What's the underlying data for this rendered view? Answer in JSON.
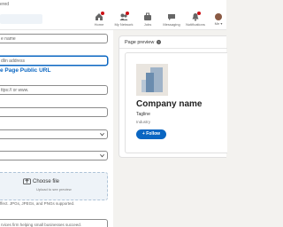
{
  "breadcrumb": "ered",
  "nav": {
    "items": [
      {
        "label": "Home",
        "icon": "home-icon",
        "badge": true
      },
      {
        "label": "My Network",
        "icon": "network-icon",
        "badge": true
      },
      {
        "label": "Jobs",
        "icon": "jobs-icon",
        "badge": false
      },
      {
        "label": "Messaging",
        "icon": "messaging-icon",
        "badge": false
      },
      {
        "label": "Notifications",
        "icon": "bell-icon",
        "badge": true
      },
      {
        "label": "Me ▾",
        "icon": "avatar",
        "badge": false
      }
    ]
  },
  "form": {
    "name_placeholder": "e name",
    "url_placeholder": "dlin address",
    "public_url_label": "e Page Public URL",
    "website_placeholder": "ttps:// or www.",
    "upload": {
      "title": "Choose file",
      "subtitle": "Upload to see preview",
      "note": "ffect. JPGs, JPEGs, and PNGs supported."
    },
    "tagline_placeholder": "rvices firm helping small businesses succeed."
  },
  "preview": {
    "heading": "Page preview",
    "company_name": "Company name",
    "tagline": "Tagline",
    "industry": "Industry",
    "follow_label": "+ Follow"
  },
  "colors": {
    "accent": "#0a66c2",
    "badge": "#cc1016",
    "page_bg": "#f3f2ef"
  }
}
